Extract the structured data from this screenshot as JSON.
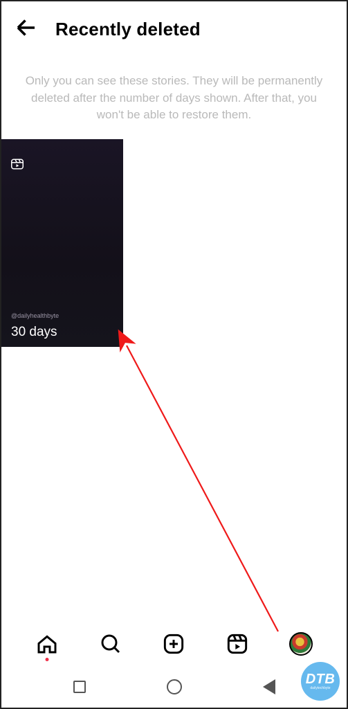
{
  "header": {
    "title": "Recently deleted"
  },
  "description": "Only you can see these stories. They will be permanently deleted after the number of days shown. After that, you won't be able to restore them.",
  "items": [
    {
      "handle": "@dailyhealthbyte",
      "days_label": "30 days"
    }
  ],
  "watermark": {
    "main": "DTB",
    "sub": "dailytechbyte"
  }
}
